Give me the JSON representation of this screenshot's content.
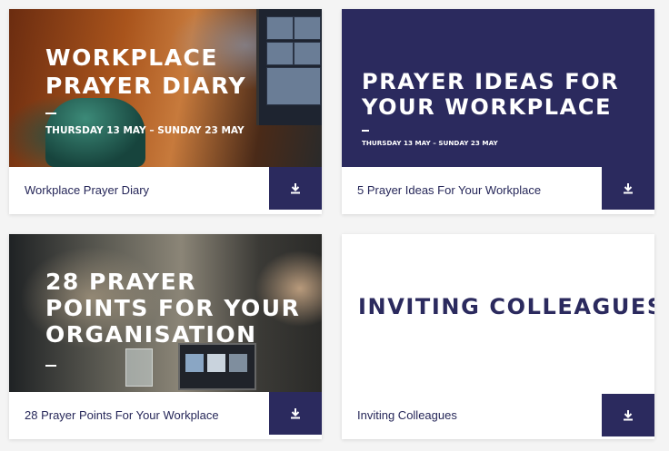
{
  "cards": [
    {
      "image_title_line1": "WORKPLACE",
      "image_title_line2": "PRAYER DIARY",
      "image_dates": "THURSDAY 13 MAY – SUNDAY 23 MAY",
      "caption": "Workplace Prayer Diary",
      "download_icon": "download-icon"
    },
    {
      "image_title_line1": "PRAYER IDEAS FOR",
      "image_title_line2": "YOUR WORKPLACE",
      "image_dates": "THURSDAY 13 MAY – SUNDAY 23 MAY",
      "caption": "5 Prayer Ideas For Your Workplace",
      "download_icon": "download-icon"
    },
    {
      "image_title_line1": "28 PRAYER",
      "image_title_line2": "POINTS FOR YOUR",
      "image_title_line3": "ORGANISATION",
      "caption": "28 Prayer Points For Your Workplace",
      "download_icon": "download-icon"
    },
    {
      "image_title_line1": "INVITING COLLEAGUES",
      "caption": "Inviting Colleagues",
      "download_icon": "download-icon"
    }
  ],
  "colors": {
    "brand_navy": "#2b2a5e",
    "caption_text": "#262759",
    "card_background": "#ffffff",
    "page_background": "#f4f4f4"
  }
}
